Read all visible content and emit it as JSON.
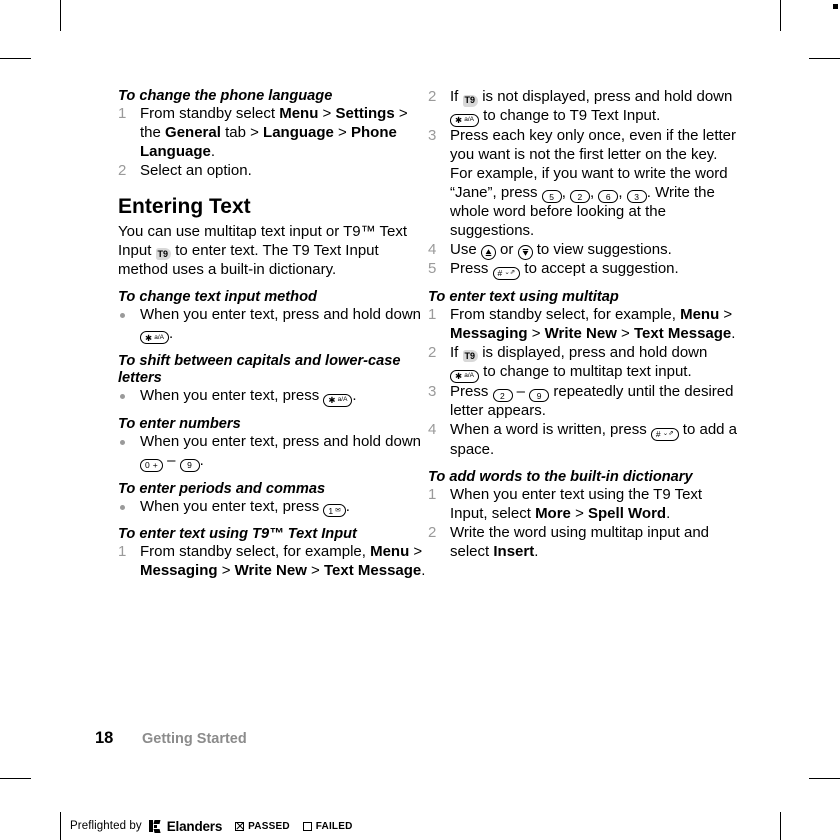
{
  "page": {
    "folio": "18",
    "running_head": "Getting Started",
    "icons": {
      "t9_indicator": "t9-indicator-icon",
      "star_key": "star-a-A-key-icon",
      "hash_key": "hash-space-key-icon",
      "zero_key": "zero-plus-key-icon",
      "one_key": "one-envelope-key-icon",
      "nav_up": "navigation-up-key-icon",
      "nav_down": "navigation-down-key-icon"
    },
    "keycaps": {
      "star": "✱ a/A",
      "hash": "# ⏎",
      "zero": "0 +",
      "one": "1 ✉",
      "two": "2",
      "three": "3",
      "five": "5",
      "six": "6",
      "nine": "9",
      "t9": "T9"
    }
  },
  "left_column": {
    "blocks": [
      {
        "kind": "subhead",
        "text": "To change the phone language"
      },
      {
        "kind": "ordered",
        "items": [
          {
            "num": "1",
            "runs": [
              {
                "t": "From standby select ",
                "b": false
              },
              {
                "t": "Menu",
                "b": true
              },
              {
                "t": " > ",
                "b": false
              },
              {
                "t": "Settings",
                "b": true
              },
              {
                "t": " > the ",
                "b": false
              },
              {
                "t": "General",
                "b": true
              },
              {
                "t": " tab > ",
                "b": false
              },
              {
                "t": "Language",
                "b": true
              },
              {
                "t": " > ",
                "b": false
              },
              {
                "t": "Phone Language",
                "b": true
              },
              {
                "t": ".",
                "b": false
              }
            ]
          },
          {
            "num": "2",
            "runs": [
              {
                "t": "Select an option.",
                "b": false
              }
            ]
          }
        ]
      },
      {
        "kind": "section",
        "text": "Entering Text"
      },
      {
        "kind": "para",
        "text_before": "You can use multitap text input or T9™ Text Input ",
        "key": "t9",
        "text_after": " to enter text. The T9 Text Input method uses a built-in dictionary."
      },
      {
        "kind": "subhead",
        "text": "To change text input method"
      },
      {
        "kind": "bullet_key",
        "text_before": "When you enter text, press and hold down ",
        "key": "star",
        "text_after": "."
      },
      {
        "kind": "subhead",
        "text": "To shift between capitals and lower-case letters"
      },
      {
        "kind": "bullet_key",
        "text_before": "When you enter text, press ",
        "key": "star",
        "text_after": "."
      },
      {
        "kind": "subhead",
        "text": "To enter numbers"
      },
      {
        "kind": "bullet_key_range",
        "text_before": "When you enter text, press and hold down ",
        "key1": "zero",
        "dash": " – ",
        "key2": "nine",
        "text_after": "."
      },
      {
        "kind": "subhead",
        "text": "To enter periods and commas"
      },
      {
        "kind": "bullet_key",
        "text_before": "When you enter text, press ",
        "key": "one",
        "text_after": "."
      },
      {
        "kind": "subhead",
        "text": "To enter text using T9™ Text Input"
      },
      {
        "kind": "ordered",
        "items": [
          {
            "num": "1",
            "runs": [
              {
                "t": "From standby select, for example, ",
                "b": false
              },
              {
                "t": "Menu",
                "b": true
              },
              {
                "t": " > ",
                "b": false
              },
              {
                "t": "Messaging",
                "b": true
              },
              {
                "t": " > ",
                "b": false
              },
              {
                "t": "Write New",
                "b": true
              },
              {
                "t": " > ",
                "b": false
              },
              {
                "t": "Text Message",
                "b": true
              },
              {
                "t": ".",
                "b": false
              }
            ]
          }
        ]
      }
    ]
  },
  "right_column": {
    "step2_before": "If ",
    "step2_mid": " is not displayed, press and hold down ",
    "step2_after": " to change to T9 Text Input.",
    "step3_a": "Press each key only once, even if the letter you want is not the first letter on the key. For example, if you want to write the word “Jane”, press ",
    "step3_b": ", ",
    "step3_c": ", ",
    "step3_d": ", ",
    "step3_e": ". Write the whole word before looking at the suggestions.",
    "step4_before": "Use ",
    "step4_mid": " or ",
    "step4_after": " to view suggestions.",
    "step5_before": "Press ",
    "step5_after": " to accept a suggestion.",
    "multitap_head": "To enter text using multitap",
    "mt1_runs": [
      {
        "t": "From standby select, for example, ",
        "b": false
      },
      {
        "t": "Menu",
        "b": true
      },
      {
        "t": " > ",
        "b": false
      },
      {
        "t": "Messaging",
        "b": true
      },
      {
        "t": " > ",
        "b": false
      },
      {
        "t": "Write New",
        "b": true
      },
      {
        "t": " > ",
        "b": false
      },
      {
        "t": "Text Message",
        "b": true
      },
      {
        "t": ".",
        "b": false
      }
    ],
    "mt2_before": "If ",
    "mt2_mid": " is displayed, press and hold down ",
    "mt2_after": " to change to multitap text input.",
    "mt3_before": "Press ",
    "mt3_dash": " – ",
    "mt3_after": " repeatedly until the desired letter appears.",
    "mt4_before": "When a word is written, press ",
    "mt4_after": " to add a space.",
    "dict_head": "To add words to the built-in dictionary",
    "d1_runs": [
      {
        "t": "When you enter text using the T9 Text Input, select ",
        "b": false
      },
      {
        "t": "More",
        "b": true
      },
      {
        "t": " > ",
        "b": false
      },
      {
        "t": "Spell Word",
        "b": true
      },
      {
        "t": ".",
        "b": false
      }
    ],
    "d2_runs": [
      {
        "t": "Write the word using multitap input and select ",
        "b": false
      },
      {
        "t": "Insert",
        "b": true
      },
      {
        "t": ".",
        "b": false
      }
    ],
    "nums": {
      "n1": "1",
      "n2": "2",
      "n3": "3",
      "n4": "4",
      "n5": "5"
    }
  },
  "preflight": {
    "prefix": "Preflighted by",
    "brand": "Elanders",
    "passed_label": "PASSED",
    "failed_label": "FAILED",
    "passed_checked": true,
    "failed_checked": false
  }
}
